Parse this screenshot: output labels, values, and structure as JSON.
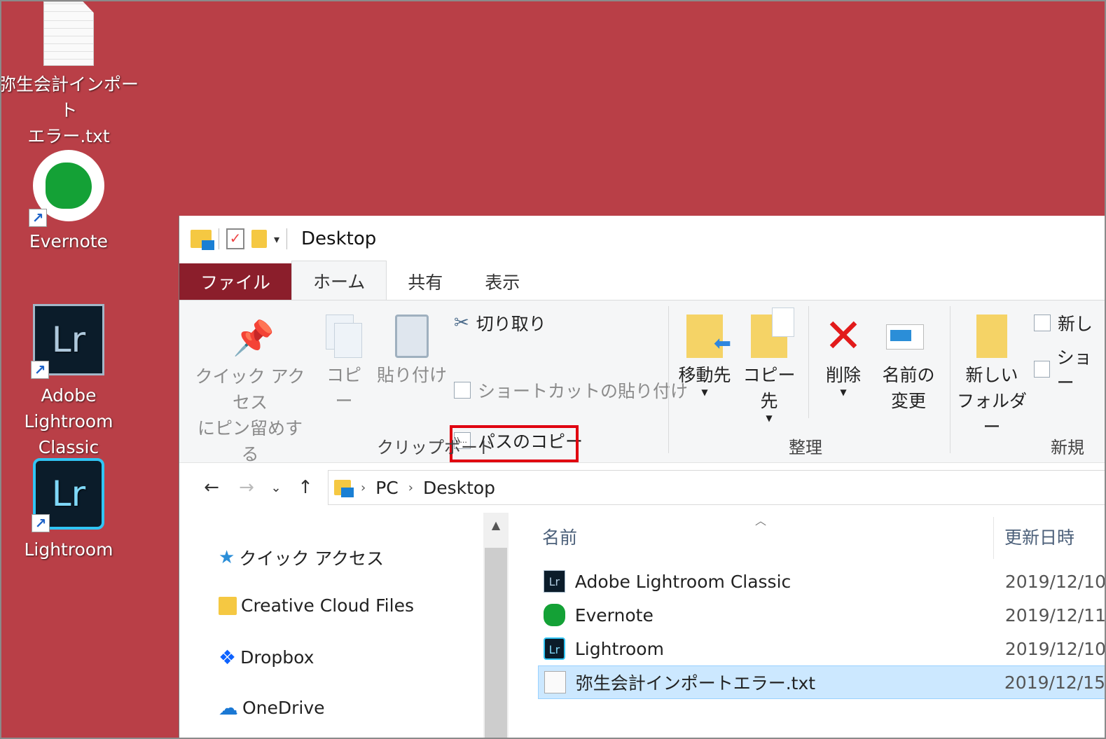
{
  "desktop": {
    "icons": [
      {
        "label_line1": "弥生会計インポート",
        "label_line2": "エラー.txt"
      },
      {
        "label_line1": "Evernote",
        "label_line2": ""
      },
      {
        "label_line1": "Adobe Lightroom",
        "label_line2": "Classic"
      },
      {
        "label_line1": "Lightroom",
        "label_line2": ""
      }
    ]
  },
  "window": {
    "title": "Desktop",
    "tabs": [
      "ファイル",
      "ホーム",
      "共有",
      "表示"
    ],
    "ribbon": {
      "clipboard": {
        "pin_line1": "クイック アクセス",
        "pin_line2": "にピン留めする",
        "copy": "コピー",
        "paste": "貼り付け",
        "cut": "切り取り",
        "copy_path": "パスのコピー",
        "paste_shortcut": "ショートカットの貼り付け",
        "label": "クリップボード"
      },
      "organize": {
        "move_to": "移動先",
        "copy_to": "コピー先",
        "delete": "削除",
        "rename_line1": "名前の",
        "rename_line2": "変更",
        "label": "整理"
      },
      "new": {
        "new_folder_line1": "新しい",
        "new_folder_line2": "フォルダー",
        "new_item": "新し",
        "shortcut": "ショー",
        "label": "新規"
      }
    },
    "address": {
      "crumbs": [
        "PC",
        "Desktop"
      ]
    },
    "nav_pane": [
      "クイック アクセス",
      "Creative Cloud Files",
      "Dropbox",
      "OneDrive"
    ],
    "columns": {
      "name": "名前",
      "date": "更新日時"
    },
    "files": [
      {
        "name": "Adobe Lightroom Classic",
        "date": "2019/12/10"
      },
      {
        "name": "Evernote",
        "date": "2019/12/11"
      },
      {
        "name": "Lightroom",
        "date": "2019/12/10"
      },
      {
        "name": "弥生会計インポートエラー.txt",
        "date": "2019/12/15"
      }
    ]
  }
}
